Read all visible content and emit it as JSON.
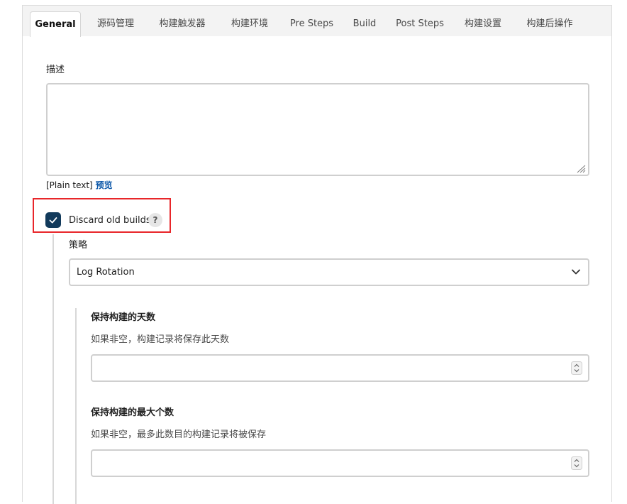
{
  "tabs": [
    {
      "label": "General",
      "active": true
    },
    {
      "label": "源码管理"
    },
    {
      "label": "构建触发器"
    },
    {
      "label": "构建环境"
    },
    {
      "label": "Pre Steps"
    },
    {
      "label": "Build"
    },
    {
      "label": "Post Steps"
    },
    {
      "label": "构建设置"
    },
    {
      "label": "构建后操作"
    }
  ],
  "description": {
    "label": "描述",
    "value": "",
    "format_prefix": "[Plain text]",
    "preview_link": "预览"
  },
  "discard_old_builds": {
    "checked": true,
    "label": "Discard old builds",
    "help_icon_text": "?"
  },
  "strategy": {
    "label": "策略",
    "selected": "Log Rotation"
  },
  "days_to_keep": {
    "label": "保持构建的天数",
    "help": "如果非空，构建记录将保存此天数",
    "value": ""
  },
  "max_to_keep": {
    "label": "保持构建的最大个数",
    "help": "如果非空，最多此数目的构建记录将被保存",
    "value": ""
  },
  "colors": {
    "checkbox": "#123a5b",
    "link": "#0a56a8",
    "highlight": "#e8262a"
  }
}
